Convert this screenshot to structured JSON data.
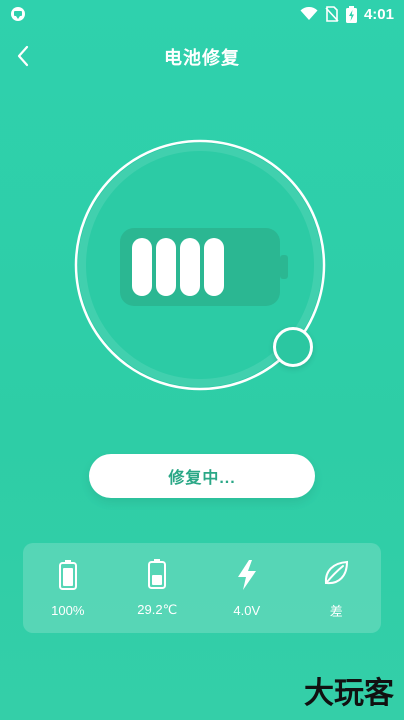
{
  "status_bar": {
    "time": "4:01"
  },
  "header": {
    "title": "电池修复"
  },
  "repair_button": {
    "label": "修复中..."
  },
  "stats": [
    {
      "icon": "battery-full-icon",
      "value": "100%"
    },
    {
      "icon": "battery-temperature-icon",
      "value": "29.2℃"
    },
    {
      "icon": "lightning-bolt-icon",
      "value": "4.0V"
    },
    {
      "icon": "leaf-health-icon",
      "value": "差"
    }
  ],
  "watermark": {
    "text": "大玩客"
  },
  "colors": {
    "background": "#2fd1ad",
    "accent_text": "#2aa786",
    "card": "rgba(255,255,255,0.18)"
  }
}
